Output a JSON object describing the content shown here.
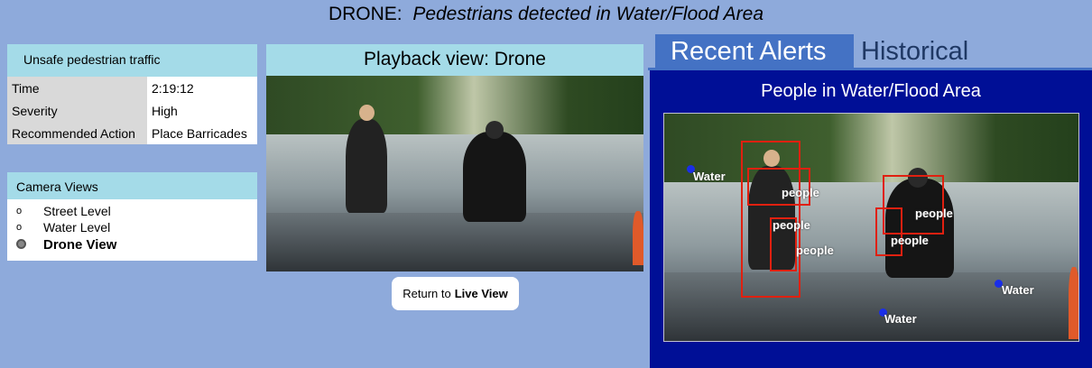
{
  "title": {
    "prefix": "DRONE:",
    "text": "Pedestrians detected in Water/Flood Area"
  },
  "incident": {
    "heading": "Unsafe pedestrian traffic",
    "rows": [
      {
        "key": "Time",
        "value": "2:19:12"
      },
      {
        "key": "Severity",
        "value": "High"
      },
      {
        "key": "Recommended Action",
        "value": "Place Barricades"
      }
    ]
  },
  "camera_views": {
    "heading": "Camera Views",
    "items": [
      {
        "label": "Street Level",
        "selected": false
      },
      {
        "label": "Water Level",
        "selected": false
      },
      {
        "label": "Drone View",
        "selected": true
      }
    ]
  },
  "playback": {
    "heading": "Playback view:  Drone"
  },
  "return_button": {
    "prefix": "Return to",
    "bold": "Live View"
  },
  "tabs": {
    "recent": "Recent Alerts",
    "historical": "Historical"
  },
  "alert": {
    "title": "People in Water/Flood Area",
    "detections": {
      "people": [
        "people",
        "people",
        "people",
        "people",
        "people"
      ],
      "water": [
        "Water",
        "Water",
        "Water"
      ]
    }
  },
  "colors": {
    "background": "#8eaadb",
    "panel_heading": "#a4dbe8",
    "alert_panel": "#000f96",
    "active_tab": "#4472c4",
    "detection_box": "#e02010",
    "water_marker": "#1a2ee8"
  }
}
